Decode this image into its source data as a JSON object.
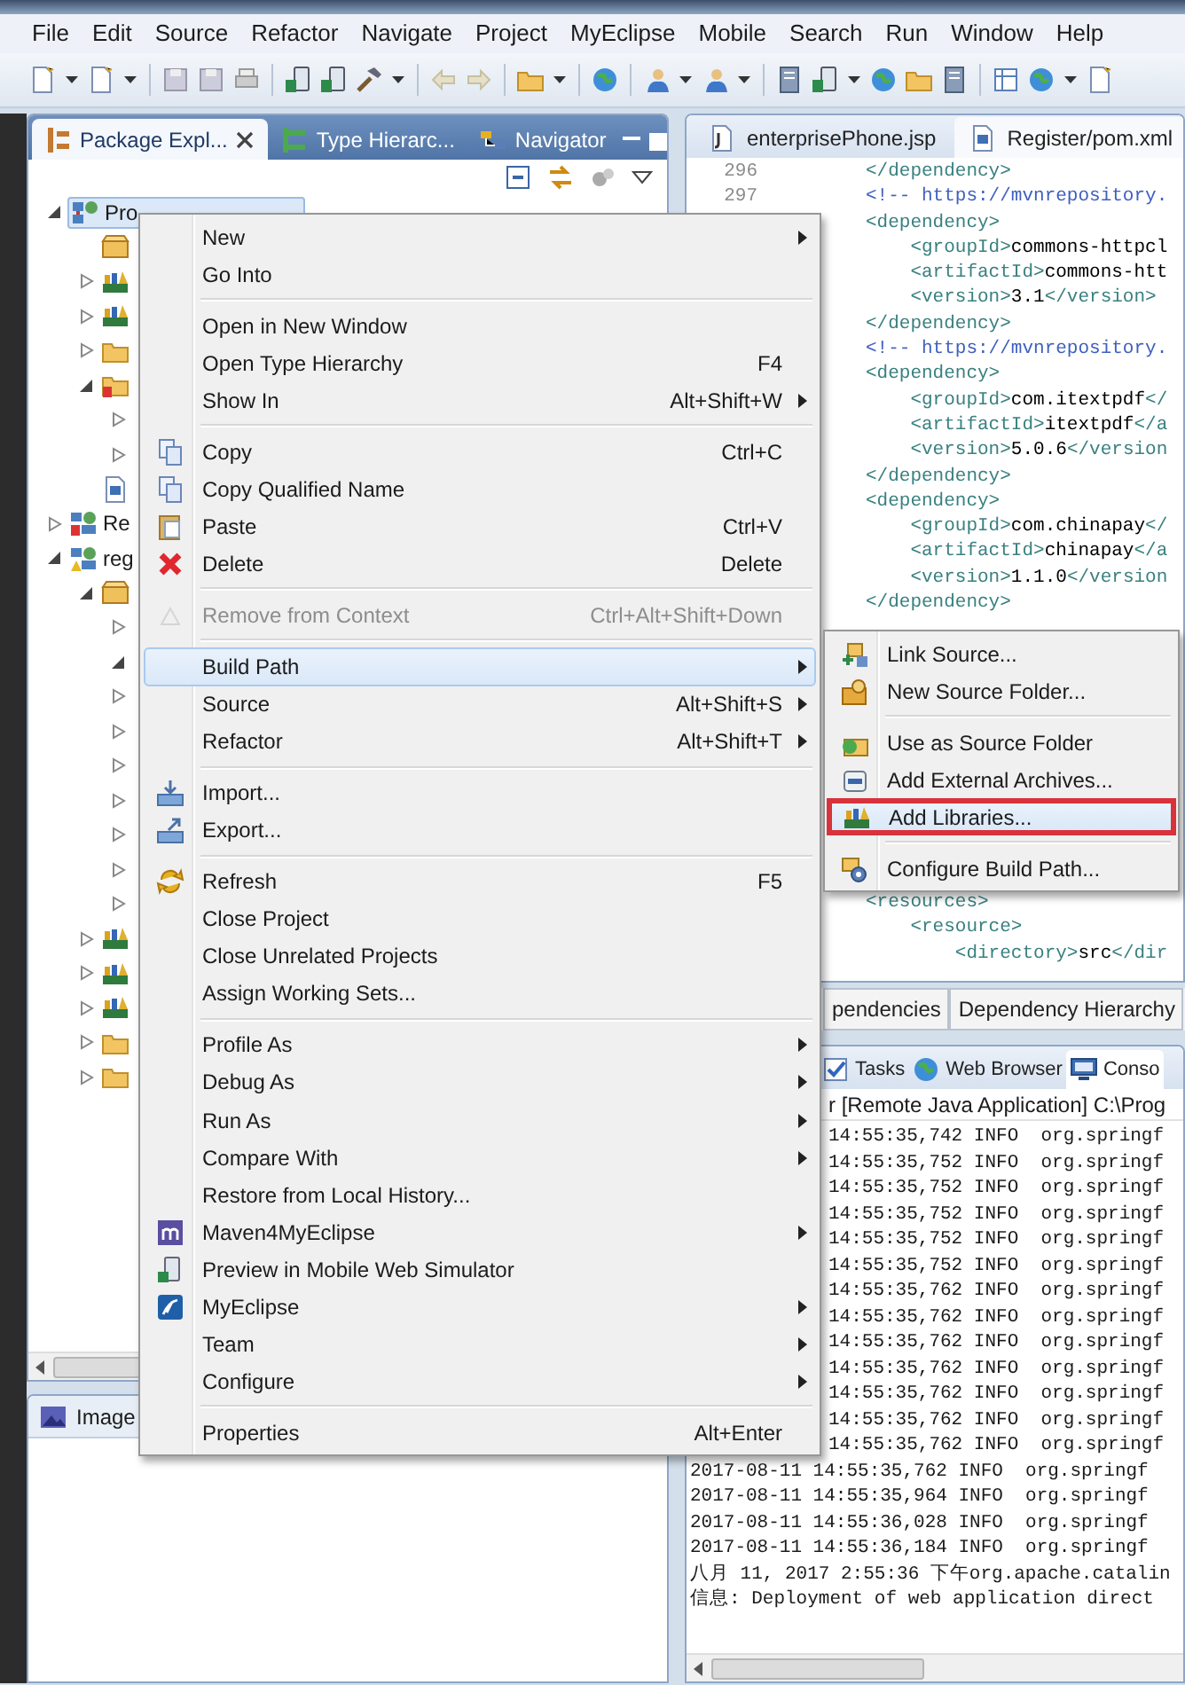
{
  "menu_bar": [
    "File",
    "Edit",
    "Source",
    "Refactor",
    "Navigate",
    "Project",
    "MyEclipse",
    "Mobile",
    "Search",
    "Run",
    "Window",
    "Help"
  ],
  "package_explorer": {
    "tabs": [
      {
        "label": "Package Expl...",
        "selected": true
      },
      {
        "label": "Type Hierarc...",
        "selected": false
      },
      {
        "label": "Navigator",
        "selected": false
      }
    ],
    "tree": [
      {
        "label": "Pro",
        "kind": "project",
        "expanded": true,
        "selected": true,
        "children": [
          {
            "kind": "package"
          },
          {
            "kind": "library",
            "expanded": false
          },
          {
            "kind": "library",
            "expanded": false
          },
          {
            "kind": "folder",
            "expanded": false
          },
          {
            "kind": "folder_error",
            "expanded": true,
            "children": [
              {
                "expanded": false
              },
              {
                "expanded": false
              }
            ]
          },
          {
            "kind": "pom"
          }
        ]
      },
      {
        "label": "Re",
        "kind": "project_error",
        "expanded": false,
        "selected": false
      },
      {
        "label": "reg",
        "kind": "project_warn",
        "expanded": true,
        "selected": false,
        "children": [
          {
            "kind": "package",
            "expanded": true,
            "children": [
              {
                "expanded": false
              },
              {
                "expanded": true
              },
              {
                "expanded": false
              },
              {
                "expanded": false
              },
              {
                "expanded": false
              },
              {
                "expanded": false
              },
              {
                "expanded": false
              },
              {
                "expanded": false
              },
              {
                "expanded": false
              }
            ]
          },
          {
            "kind": "library",
            "expanded": false
          },
          {
            "kind": "library",
            "expanded": false
          },
          {
            "kind": "library",
            "expanded": false
          },
          {
            "kind": "folder",
            "expanded": false
          },
          {
            "kind": "folder",
            "expanded": false
          }
        ]
      }
    ]
  },
  "image_panel": {
    "tab": "Image"
  },
  "editor": {
    "tabs": [
      {
        "label": "enterprisePhone.jsp",
        "kind": "jsp",
        "selected": false
      },
      {
        "label": "Register/pom.xml",
        "kind": "pom",
        "selected": true
      }
    ],
    "code_blocks": [
      {
        "lines": [
          {
            "number": "296",
            "parts": [
              {
                "kind": "tag",
                "text": "</dependency>"
              }
            ]
          },
          {
            "number": "297",
            "parts": [
              {
                "kind": "comment",
                "text": "<!-- https://mvnrepository."
              }
            ]
          },
          {
            "parts": [
              {
                "kind": "tag",
                "text": "<dependency>"
              }
            ]
          },
          {
            "parts": [
              {
                "kind": "tag",
                "text": "    <groupId>"
              },
              {
                "kind": "value",
                "text": "commons-httpcl"
              }
            ]
          },
          {
            "parts": [
              {
                "kind": "tag",
                "text": "    <artifactId>"
              },
              {
                "kind": "value",
                "text": "commons-htt"
              }
            ]
          },
          {
            "parts": [
              {
                "kind": "tag",
                "text": "    <version>"
              },
              {
                "kind": "value",
                "text": "3.1"
              },
              {
                "kind": "tag",
                "text": "</version>"
              }
            ]
          },
          {
            "parts": [
              {
                "kind": "tag",
                "text": "</dependency>"
              }
            ]
          },
          {
            "parts": [
              {
                "kind": "comment",
                "text": "<!-- https://mvnrepository."
              }
            ]
          },
          {
            "parts": [
              {
                "kind": "tag",
                "text": "<dependency>"
              }
            ]
          },
          {
            "parts": [
              {
                "kind": "tag",
                "text": "    <groupId>"
              },
              {
                "kind": "value",
                "text": "com.itextpdf"
              },
              {
                "kind": "tag",
                "text": "</"
              }
            ]
          },
          {
            "parts": [
              {
                "kind": "tag",
                "text": "    <artifactId>"
              },
              {
                "kind": "value",
                "text": "itextpdf"
              },
              {
                "kind": "tag",
                "text": "</a"
              }
            ]
          },
          {
            "parts": [
              {
                "kind": "tag",
                "text": "    <version>"
              },
              {
                "kind": "value",
                "text": "5.0.6"
              },
              {
                "kind": "tag",
                "text": "</version"
              }
            ]
          },
          {
            "parts": [
              {
                "kind": "tag",
                "text": "</dependency>"
              }
            ]
          },
          {
            "parts": [
              {
                "kind": "tag",
                "text": "<dependency>"
              }
            ]
          },
          {
            "parts": [
              {
                "kind": "tag",
                "text": "    <groupId>"
              },
              {
                "kind": "value",
                "text": "com.chinapay"
              },
              {
                "kind": "tag",
                "text": "</"
              }
            ]
          },
          {
            "parts": [
              {
                "kind": "tag",
                "text": "    <artifactId>"
              },
              {
                "kind": "value",
                "text": "chinapay"
              },
              {
                "kind": "tag",
                "text": "</a"
              }
            ]
          },
          {
            "parts": [
              {
                "kind": "tag",
                "text": "    <version>"
              },
              {
                "kind": "value",
                "text": "1.1.0"
              },
              {
                "kind": "tag",
                "text": "</version"
              }
            ]
          },
          {
            "parts": [
              {
                "kind": "tag",
                "text": "</dependency>"
              }
            ]
          }
        ]
      },
      {
        "lines": [
          {
            "parts": [
              {
                "kind": "tag",
                "text": "<resources>"
              }
            ]
          },
          {
            "parts": [
              {
                "kind": "tag",
                "text": "    <resource>"
              }
            ]
          },
          {
            "parts": [
              {
                "kind": "tag",
                "text": "        <directory>"
              },
              {
                "kind": "value",
                "text": "src"
              },
              {
                "kind": "tag",
                "text": "</dir"
              }
            ]
          }
        ]
      }
    ]
  },
  "pom_tabs": [
    "pendencies",
    "Dependency Hierarchy"
  ],
  "console": {
    "tabs": [
      {
        "label": "Tasks",
        "kind": "tasks",
        "selected": false
      },
      {
        "label": "Web Browser",
        "kind": "globe",
        "selected": false
      },
      {
        "label": "Conso",
        "kind": "monitor",
        "selected": true
      }
    ],
    "header": "r [Remote Java Application] C:\\Prog",
    "lines": [
      {
        "kind": "partial",
        "text": "14:55:35,742 INFO  org.springf"
      },
      {
        "kind": "partial",
        "text": "14:55:35,752 INFO  org.springf"
      },
      {
        "kind": "partial",
        "text": "14:55:35,752 INFO  org.springf"
      },
      {
        "kind": "partial",
        "text": "14:55:35,752 INFO  org.springf"
      },
      {
        "kind": "partial",
        "text": "14:55:35,752 INFO  org.springf"
      },
      {
        "kind": "partial",
        "text": "14:55:35,752 INFO  org.springf"
      },
      {
        "kind": "partial",
        "text": "14:55:35,762 INFO  org.springf"
      },
      {
        "kind": "partial",
        "text": "14:55:35,762 INFO  org.springf"
      },
      {
        "kind": "partial",
        "text": "14:55:35,762 INFO  org.springf"
      },
      {
        "kind": "partial",
        "text": "14:55:35,762 INFO  org.springf"
      },
      {
        "kind": "partial",
        "text": "14:55:35,762 INFO  org.springf"
      },
      {
        "kind": "partial",
        "text": "14:55:35,762 INFO  org.springf"
      },
      {
        "kind": "partial",
        "text": "14:55:35,762 INFO  org.springf"
      },
      {
        "kind": "full",
        "text": "2017-08-11 14:55:35,762 INFO  org.springf"
      },
      {
        "kind": "full",
        "text": "2017-08-11 14:55:35,964 INFO  org.springf"
      },
      {
        "kind": "full",
        "text": "2017-08-11 14:55:36,028 INFO  org.springf"
      },
      {
        "kind": "full",
        "text": "2017-08-11 14:55:36,184 INFO  org.springf"
      },
      {
        "kind": "full",
        "text": "八月 11, 2017 2:55:36 下午org.apache.catalin"
      },
      {
        "kind": "full",
        "text": "信息: Deployment of web application direct"
      }
    ]
  },
  "context_menu": {
    "groups": [
      [
        {
          "label": "New",
          "submenu": true,
          "selected": false,
          "disabled": false
        },
        {
          "label": "Go Into",
          "submenu": false,
          "selected": false,
          "disabled": false
        }
      ],
      [
        {
          "label": "Open in New Window",
          "submenu": false,
          "selected": false,
          "disabled": false
        },
        {
          "label": "Open Type Hierarchy",
          "shortcut": "F4",
          "submenu": false,
          "selected": false,
          "disabled": false
        },
        {
          "label": "Show In",
          "shortcut": "Alt+Shift+W",
          "submenu": true,
          "selected": false,
          "disabled": false
        }
      ],
      [
        {
          "label": "Copy",
          "kind": "copy",
          "shortcut": "Ctrl+C",
          "submenu": false,
          "selected": false,
          "disabled": false
        },
        {
          "label": "Copy Qualified Name",
          "kind": "copy",
          "submenu": false,
          "selected": false,
          "disabled": false
        },
        {
          "label": "Paste",
          "kind": "paste",
          "shortcut": "Ctrl+V",
          "submenu": false,
          "selected": false,
          "disabled": false
        },
        {
          "label": "Delete",
          "kind": "delete",
          "shortcut": "Delete",
          "submenu": false,
          "selected": false,
          "disabled": false
        }
      ],
      [
        {
          "label": "Remove from Context",
          "kind": "remove",
          "shortcut": "Ctrl+Alt+Shift+Down",
          "submenu": false,
          "selected": false,
          "disabled": true
        }
      ],
      [
        {
          "label": "Build Path",
          "submenu": true,
          "selected": true,
          "disabled": false
        },
        {
          "label": "Source",
          "shortcut": "Alt+Shift+S",
          "submenu": true,
          "selected": false,
          "disabled": false
        },
        {
          "label": "Refactor",
          "shortcut": "Alt+Shift+T",
          "submenu": true,
          "selected": false,
          "disabled": false
        }
      ],
      [
        {
          "label": "Import...",
          "kind": "import",
          "submenu": false,
          "selected": false,
          "disabled": false
        },
        {
          "label": "Export...",
          "kind": "export",
          "submenu": false,
          "selected": false,
          "disabled": false
        }
      ],
      [
        {
          "label": "Refresh",
          "kind": "refresh",
          "shortcut": "F5",
          "submenu": false,
          "selected": false,
          "disabled": false
        },
        {
          "label": "Close Project",
          "submenu": false,
          "selected": false,
          "disabled": false
        },
        {
          "label": "Close Unrelated Projects",
          "submenu": false,
          "selected": false,
          "disabled": false
        },
        {
          "label": "Assign Working Sets...",
          "submenu": false,
          "selected": false,
          "disabled": false
        }
      ],
      [
        {
          "label": "Profile As",
          "submenu": true,
          "selected": false,
          "disabled": false
        },
        {
          "label": "Debug As",
          "submenu": true,
          "selected": false,
          "disabled": false
        },
        {
          "label": "Run As",
          "submenu": true,
          "selected": false,
          "disabled": false
        },
        {
          "label": "Compare With",
          "submenu": true,
          "selected": false,
          "disabled": false
        },
        {
          "label": "Restore from Local History...",
          "submenu": false,
          "selected": false,
          "disabled": false
        },
        {
          "label": "Maven4MyEclipse",
          "kind": "maven",
          "submenu": true,
          "selected": false,
          "disabled": false
        },
        {
          "label": "Preview in Mobile Web Simulator",
          "kind": "preview",
          "submenu": false,
          "selected": false,
          "disabled": false
        },
        {
          "label": "MyEclipse",
          "kind": "myeclipse",
          "submenu": true,
          "selected": false,
          "disabled": false
        },
        {
          "label": "Team",
          "submenu": true,
          "selected": false,
          "disabled": false
        },
        {
          "label": "Configure",
          "submenu": true,
          "selected": false,
          "disabled": false
        }
      ],
      [
        {
          "label": "Properties",
          "shortcut": "Alt+Enter",
          "submenu": false,
          "selected": false,
          "disabled": false
        }
      ]
    ]
  },
  "build_path_submenu": {
    "groups": [
      [
        {
          "label": "Link Source...",
          "kind": "link",
          "selected": false,
          "highlighted": false
        },
        {
          "label": "New Source Folder...",
          "kind": "new_folder",
          "selected": false,
          "highlighted": false
        }
      ],
      [
        {
          "label": "Use as Source Folder",
          "kind": "use_source",
          "selected": false,
          "highlighted": false
        },
        {
          "label": "Add External Archives...",
          "kind": "archive",
          "selected": false,
          "highlighted": false
        },
        {
          "label": "Add Libraries...",
          "kind": "library",
          "selected": true,
          "highlighted": true
        }
      ],
      [
        {
          "label": "Configure Build Path...",
          "kind": "configure",
          "selected": false,
          "highlighted": false
        }
      ]
    ]
  }
}
